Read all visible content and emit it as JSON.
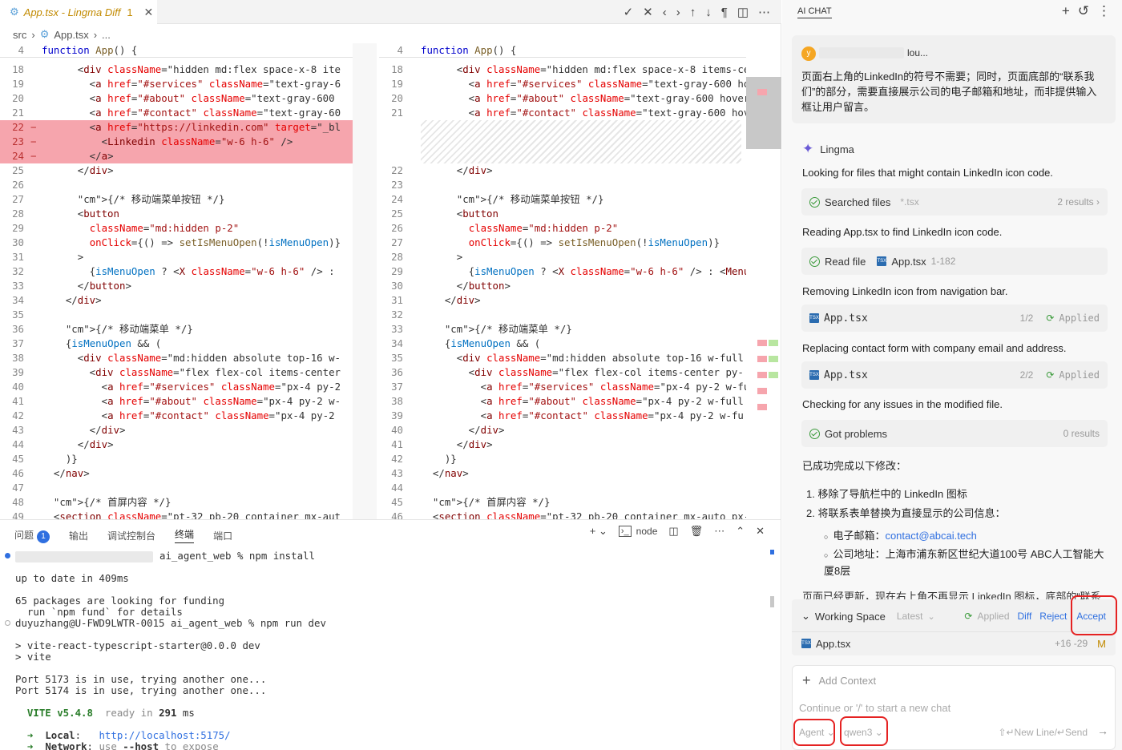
{
  "tab": {
    "title": "App.tsx - Lingma Diff",
    "badge": "1",
    "close": "✕"
  },
  "toolbar_icons": [
    "check-icon",
    "close-icon",
    "chevron-left-icon",
    "chevron-right-icon",
    "arrow-up-icon",
    "arrow-down-icon",
    "pilcrow-icon",
    "split-icon",
    "more-icon"
  ],
  "breadcrumb": {
    "src": "src",
    "file": "App.tsx",
    "more": "..."
  },
  "left": {
    "header_ln": "4",
    "lines": [
      {
        "n": "18",
        "c": "      <div className=\"hidden md:flex space-x-8 ite"
      },
      {
        "n": "19",
        "c": "        <a href=\"#services\" className=\"text-gray-6"
      },
      {
        "n": "20",
        "c": "        <a href=\"#about\" className=\"text-gray-600"
      },
      {
        "n": "21",
        "c": "        <a href=\"#contact\" className=\"text-gray-60"
      },
      {
        "n": "22",
        "c": "        <a href=\"https://linkedin.com\" target=\"_bl",
        "d": true
      },
      {
        "n": "23",
        "c": "          <Linkedin className=\"w-6 h-6\" />",
        "d": true
      },
      {
        "n": "24",
        "c": "        </a>",
        "d": true
      },
      {
        "n": "25",
        "c": "      </div>"
      },
      {
        "n": "26",
        "c": ""
      },
      {
        "n": "27",
        "c": "      {/* 移动端菜单按钮 */}"
      },
      {
        "n": "28",
        "c": "      <button"
      },
      {
        "n": "29",
        "c": "        className=\"md:hidden p-2\""
      },
      {
        "n": "30",
        "c": "        onClick={() => setIsMenuOpen(!isMenuOpen)}"
      },
      {
        "n": "31",
        "c": "      >"
      },
      {
        "n": "32",
        "c": "        {isMenuOpen ? <X className=\"w-6 h-6\" /> :"
      },
      {
        "n": "33",
        "c": "      </button>"
      },
      {
        "n": "34",
        "c": "    </div>"
      },
      {
        "n": "35",
        "c": ""
      },
      {
        "n": "36",
        "c": "    {/* 移动端菜单 */}"
      },
      {
        "n": "37",
        "c": "    {isMenuOpen && ("
      },
      {
        "n": "38",
        "c": "      <div className=\"md:hidden absolute top-16 w-"
      },
      {
        "n": "39",
        "c": "        <div className=\"flex flex-col items-center"
      },
      {
        "n": "40",
        "c": "          <a href=\"#services\" className=\"px-4 py-2"
      },
      {
        "n": "41",
        "c": "          <a href=\"#about\" className=\"px-4 py-2 w-"
      },
      {
        "n": "42",
        "c": "          <a href=\"#contact\" className=\"px-4 py-2"
      },
      {
        "n": "43",
        "c": "        </div>"
      },
      {
        "n": "44",
        "c": "      </div>"
      },
      {
        "n": "45",
        "c": "    )}"
      },
      {
        "n": "46",
        "c": "  </nav>"
      },
      {
        "n": "47",
        "c": ""
      },
      {
        "n": "48",
        "c": "  {/* 首屏内容 */}"
      },
      {
        "n": "49",
        "c": "  <section className=\"pt-32 pb-20 container mx-aut"
      }
    ]
  },
  "right": {
    "header_ln": "4",
    "lines": [
      {
        "n": "18",
        "c": "      <div className=\"hidden md:flex space-x-8 items-ce"
      },
      {
        "n": "19",
        "c": "        <a href=\"#services\" className=\"text-gray-600 ho"
      },
      {
        "n": "20",
        "c": "        <a href=\"#about\" className=\"text-gray-600 hover"
      },
      {
        "n": "21",
        "c": "        <a href=\"#contact\" className=\"text-gray-600 hov"
      },
      {
        "n": "",
        "c": ""
      },
      {
        "n": "",
        "c": ""
      },
      {
        "n": "",
        "c": ""
      },
      {
        "n": "22",
        "c": "      </div>"
      },
      {
        "n": "23",
        "c": ""
      },
      {
        "n": "24",
        "c": "      {/* 移动端菜单按钮 */}"
      },
      {
        "n": "25",
        "c": "      <button"
      },
      {
        "n": "26",
        "c": "        className=\"md:hidden p-2\""
      },
      {
        "n": "27",
        "c": "        onClick={() => setIsMenuOpen(!isMenuOpen)}"
      },
      {
        "n": "28",
        "c": "      >"
      },
      {
        "n": "29",
        "c": "        {isMenuOpen ? <X className=\"w-6 h-6\" /> : <Menu"
      },
      {
        "n": "30",
        "c": "      </button>"
      },
      {
        "n": "31",
        "c": "    </div>"
      },
      {
        "n": "32",
        "c": ""
      },
      {
        "n": "33",
        "c": "    {/* 移动端菜单 */}"
      },
      {
        "n": "34",
        "c": "    {isMenuOpen && ("
      },
      {
        "n": "35",
        "c": "      <div className=\"md:hidden absolute top-16 w-full"
      },
      {
        "n": "36",
        "c": "        <div className=\"flex flex-col items-center py-"
      },
      {
        "n": "37",
        "c": "          <a href=\"#services\" className=\"px-4 py-2 w-fu"
      },
      {
        "n": "38",
        "c": "          <a href=\"#about\" className=\"px-4 py-2 w-full"
      },
      {
        "n": "39",
        "c": "          <a href=\"#contact\" className=\"px-4 py-2 w-fu"
      },
      {
        "n": "40",
        "c": "        </div>"
      },
      {
        "n": "41",
        "c": "      </div>"
      },
      {
        "n": "42",
        "c": "    )}"
      },
      {
        "n": "43",
        "c": "  </nav>"
      },
      {
        "n": "44",
        "c": ""
      },
      {
        "n": "45",
        "c": "  {/* 首屏内容 */}"
      },
      {
        "n": "46",
        "c": "  <section className=\"pt-32 pb-20 container mx-auto px-"
      }
    ]
  },
  "panel": {
    "tabs": [
      "问题",
      "输出",
      "调试控制台",
      "终端",
      "端口"
    ],
    "problems_count": "1",
    "node": "node",
    "terminal": [
      "ai_agent_web % npm install",
      "",
      "up to date in 409ms",
      "",
      "65 packages are looking for funding",
      "  run `npm fund` for details",
      "duyuzhang@U-FWD9LWTR-0015 ai_agent_web % npm run dev",
      "",
      "> vite-react-typescript-starter@0.0.0 dev",
      "> vite",
      "",
      "Port 5173 is in use, trying another one...",
      "Port 5174 is in use, trying another one...",
      "",
      "  VITE v5.4.8  ready in 291 ms",
      "",
      "  ➜  Local:   http://localhost:5175/",
      "  ➜  Network: use --host to expose"
    ]
  },
  "chat": {
    "title": "AI CHAT",
    "user": {
      "initial": "y",
      "name": "lou...",
      "message": "页面右上角的LinkedIn的符号不需要；同时，页面底部的“联系我们”的部分，需要直接展示公司的电子邮箱和地址，而非提供输入框让用户留言。"
    },
    "agent": "Lingma",
    "s1": "Looking for files that might contain LinkedIn icon code.",
    "c1": {
      "label": "Searched files",
      "hint": "*.tsx",
      "r": "2 results ›"
    },
    "s2": "Reading App.tsx to find LinkedIn icon code.",
    "c2": {
      "label": "Read file",
      "file": "App.tsx",
      "range": "1-182"
    },
    "s3": "Removing LinkedIn icon from navigation bar.",
    "c3": {
      "file": "App.tsx",
      "step": "1/2",
      "status": "Applied"
    },
    "s4": "Replacing contact form with company email and address.",
    "c4": {
      "file": "App.tsx",
      "step": "2/2",
      "status": "Applied"
    },
    "s5": "Checking for any issues in the modified file.",
    "c5": {
      "label": "Got problems",
      "r": "0 results"
    },
    "summary": "已成功完成以下修改：",
    "item1": "1. 移除了导航栏中的 LinkedIn 图标",
    "item2": "2. 将联系表单替换为直接显示的公司信息：",
    "email_label": "电子邮箱：",
    "email": "contact@abcai.tech",
    "addr_label": "公司地址：",
    "addr": "上海市浦东新区世纪大道100号 ABC人工智能大厦8层",
    "cut": "页面已经更新，现在右上角不再显示 LinkedIn 图标，底部的“联系",
    "ws": {
      "title": "Working Space",
      "version": "Latest",
      "applied": "Applied",
      "diff": "Diff",
      "reject": "Reject",
      "accept": "Accept",
      "file": "App.tsx",
      "stats": "+16 -29",
      "mark": "M"
    },
    "input": {
      "add_context": "Add Context",
      "placeholder": "Continue or '/' to start a new chat",
      "mode": "Agent",
      "model": "qwen3",
      "hint": "⇧↵New Line/↵Send"
    }
  }
}
